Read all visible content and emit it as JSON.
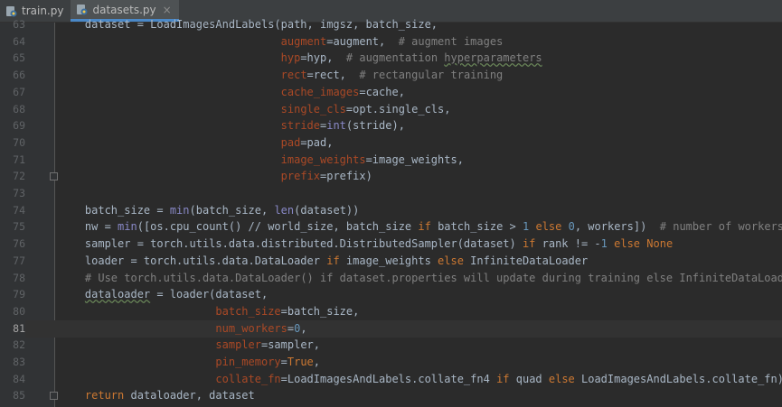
{
  "tabs": [
    {
      "label": "train.py",
      "icon": "python-file-icon",
      "active": false
    },
    {
      "label": "datasets.py",
      "icon": "python-file-icon",
      "active": true,
      "close": "×"
    }
  ],
  "editor": {
    "current_line": "81",
    "lines": [
      {
        "n": "63",
        "text": "    dataset = LoadImagesAndLabels(path, imgsz, batch_size,"
      },
      {
        "n": "64",
        "text": "                                  augment=augment,  # augment images"
      },
      {
        "n": "65",
        "text": "                                  hyp=hyp,  # augmentation hyperparameters"
      },
      {
        "n": "66",
        "text": "                                  rect=rect,  # rectangular training"
      },
      {
        "n": "67",
        "text": "                                  cache_images=cache,"
      },
      {
        "n": "68",
        "text": "                                  single_cls=opt.single_cls,"
      },
      {
        "n": "69",
        "text": "                                  stride=int(stride),"
      },
      {
        "n": "70",
        "text": "                                  pad=pad,"
      },
      {
        "n": "71",
        "text": "                                  image_weights=image_weights,"
      },
      {
        "n": "72",
        "text": "                                  prefix=prefix)"
      },
      {
        "n": "73",
        "text": ""
      },
      {
        "n": "74",
        "text": "    batch_size = min(batch_size, len(dataset))"
      },
      {
        "n": "75",
        "text": "    nw = min([os.cpu_count() // world_size, batch_size if batch_size > 1 else 0, workers])  # number of workers"
      },
      {
        "n": "76",
        "text": "    sampler = torch.utils.data.distributed.DistributedSampler(dataset) if rank != -1 else None"
      },
      {
        "n": "77",
        "text": "    loader = torch.utils.data.DataLoader if image_weights else InfiniteDataLoader"
      },
      {
        "n": "78",
        "text": "    # Use torch.utils.data.DataLoader() if dataset.properties will update during training else InfiniteDataLoader()"
      },
      {
        "n": "79",
        "text": "    dataloader = loader(dataset,"
      },
      {
        "n": "80",
        "text": "                        batch_size=batch_size,"
      },
      {
        "n": "81",
        "text": "                        num_workers=0,"
      },
      {
        "n": "82",
        "text": "                        sampler=sampler,"
      },
      {
        "n": "83",
        "text": "                        pin_memory=True,"
      },
      {
        "n": "84",
        "text": "                        collate_fn=LoadImagesAndLabels.collate_fn4 if quad else LoadImagesAndLabels.collate_fn)"
      },
      {
        "n": "85",
        "text": "    return dataloader, dataset"
      }
    ]
  },
  "colors": {
    "background": "#2b2b2b",
    "keyword": "#cc7832",
    "param": "#aa4926",
    "number": "#6897bb",
    "comment": "#808080",
    "builtin": "#8888c6",
    "text": "#a9b7c6"
  }
}
